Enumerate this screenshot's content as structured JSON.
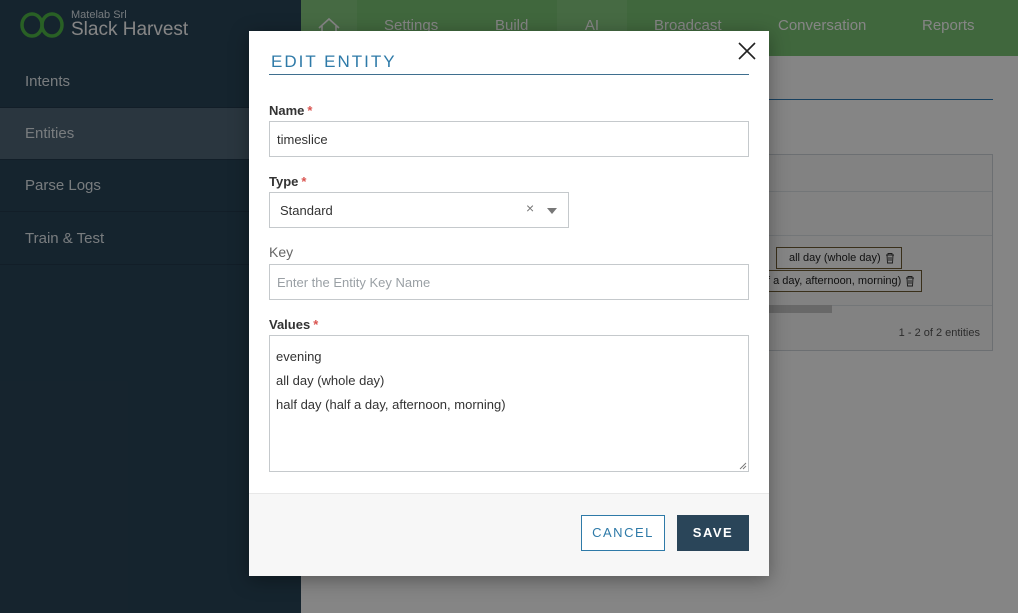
{
  "brand": {
    "company": "Matelab Srl",
    "title": "Slack Harvest"
  },
  "sidebar": {
    "items": [
      {
        "label": "Intents"
      },
      {
        "label": "Entities"
      },
      {
        "label": "Parse Logs"
      },
      {
        "label": "Train & Test"
      }
    ],
    "active": "Entities"
  },
  "topnav": {
    "items": [
      {
        "label": "Settings"
      },
      {
        "label": "Build"
      },
      {
        "label": "AI"
      },
      {
        "label": "Broadcast"
      },
      {
        "label": "Conversation"
      },
      {
        "label": "Reports"
      }
    ],
    "active": "AI"
  },
  "background": {
    "chips": [
      "all day (whole day)",
      "f a day, afternoon, morning)"
    ],
    "pager": "1 - 2 of 2 entities"
  },
  "modal": {
    "title": "EDIT ENTITY",
    "name": {
      "label": "Name",
      "required": "*",
      "value": "timeslice"
    },
    "type": {
      "label": "Type",
      "required": "*",
      "value": "Standard",
      "clear": "×"
    },
    "key": {
      "label": "Key",
      "placeholder": "Enter the Entity Key Name",
      "value": ""
    },
    "values": {
      "label": "Values",
      "required": "*",
      "lines": [
        "evening",
        "all day (whole day)",
        "half day (half a day, afternoon, morning)"
      ]
    },
    "cancel_label": "CANCEL",
    "save_label": "SAVE"
  },
  "colors": {
    "sidebar": "#2a4559",
    "topnav": "#7cc576",
    "accent": "#2e7aa8",
    "save_button": "#2a4559",
    "required": "#d9534f"
  }
}
